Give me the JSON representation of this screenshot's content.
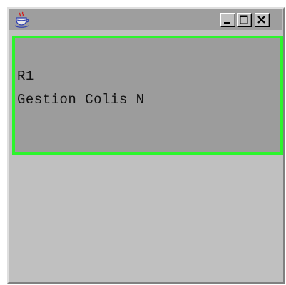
{
  "window": {
    "titlebar": {
      "title": "",
      "icon": "java-cup-icon",
      "buttons": [
        "minimize",
        "maximize",
        "close"
      ]
    }
  },
  "panel": {
    "lines": [
      "R1",
      "Gestion Colis N"
    ],
    "border_color": "#2cf52c",
    "background_color": "#9c9c9c"
  },
  "colors": {
    "window_bg": "#c0c0c0",
    "titlebar_bg": "#9e9e9e"
  }
}
